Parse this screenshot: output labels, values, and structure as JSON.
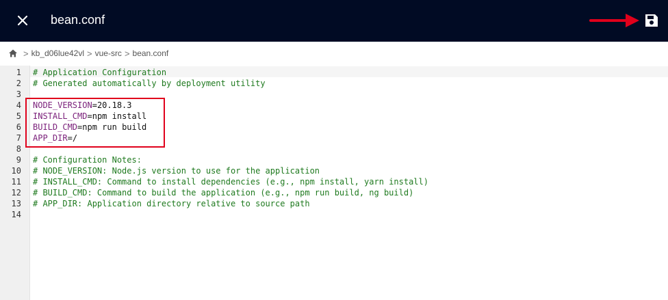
{
  "header": {
    "title": "bean.conf",
    "close_icon": "close-icon",
    "save_icon": "save-disk-icon",
    "annotation_color": "#e0001b",
    "bg_color": "#010b24"
  },
  "breadcrumb": {
    "home_icon": "home-icon",
    "items": [
      "kb_d06lue42vl",
      "vue-src",
      "bean.conf"
    ],
    "separator": ">"
  },
  "editor": {
    "line_numbers": [
      "1",
      "2",
      "3",
      "4",
      "5",
      "6",
      "7",
      "8",
      "9",
      "10",
      "11",
      "12",
      "13",
      "14"
    ],
    "lines": [
      {
        "comment": "# Application Configuration"
      },
      {
        "comment": "# Generated automatically by deployment utility"
      },
      {},
      {
        "key": "NODE_VERSION",
        "eq": "=",
        "value": "20.18.3"
      },
      {
        "key": "INSTALL_CMD",
        "eq": "=",
        "value": "npm install"
      },
      {
        "key": "BUILD_CMD",
        "eq": "=",
        "value": "npm run build"
      },
      {
        "key": "APP_DIR",
        "eq": "=",
        "value": "/"
      },
      {},
      {
        "comment": "# Configuration Notes:"
      },
      {
        "comment": "# NODE_VERSION: Node.js version to use for the application"
      },
      {
        "comment": "# INSTALL_CMD: Command to install dependencies (e.g., npm install, yarn install)"
      },
      {
        "comment": "# BUILD_CMD: Command to build the application (e.g., npm run build, ng build)"
      },
      {
        "comment": "# APP_DIR: Application directory relative to source path"
      },
      {}
    ]
  }
}
